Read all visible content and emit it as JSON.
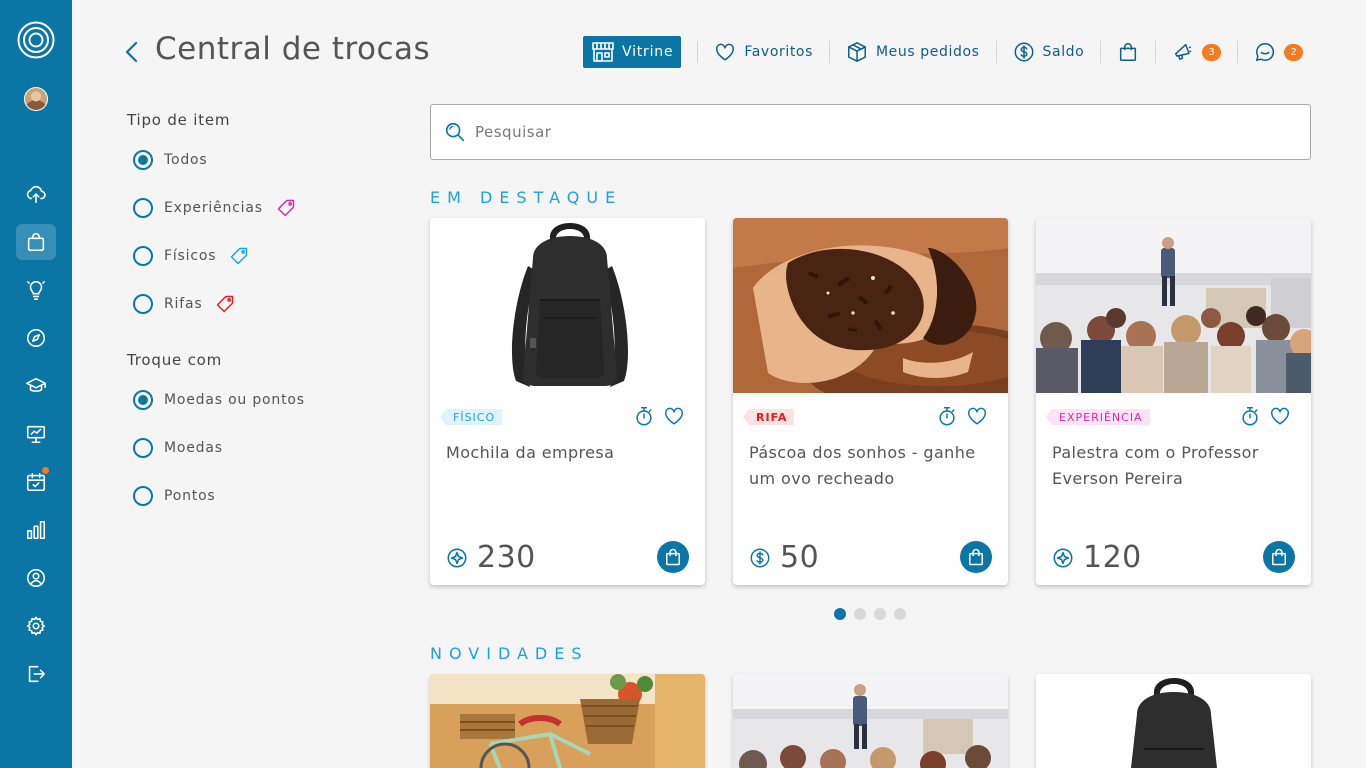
{
  "header": {
    "title": "Central de trocas"
  },
  "nav": {
    "vitrine": "Vitrine",
    "favoritos": "Favoritos",
    "pedidos": "Meus pedidos",
    "saldo": "Saldo",
    "notif_count": "3",
    "msg_count": "2"
  },
  "filters": {
    "tipo_heading": "Tipo de item",
    "tipo_options": [
      "Todos",
      "Experiências",
      "Físicos",
      "Rifas"
    ],
    "tipo_selected": "Todos",
    "troque_heading": "Troque com",
    "troque_options": [
      "Moedas ou pontos",
      "Moedas",
      "Pontos"
    ],
    "troque_selected": "Moedas ou pontos"
  },
  "search": {
    "placeholder": "Pesquisar"
  },
  "featured": {
    "heading": "EM DESTAQUE",
    "cards": [
      {
        "tag": "FÍSICO",
        "title": "Mochila da empresa",
        "price": "230",
        "currency_icon": "points-icon",
        "image": "black-backpack"
      },
      {
        "tag": "RIFA",
        "title": "Páscoa dos sonhos - ganhe um ovo recheado",
        "price": "50",
        "currency_icon": "coin-icon",
        "image": "chocolate-easter-egg"
      },
      {
        "tag": "EXPERIÊNCIA",
        "title": "Palestra com o Professor Everson Pereira",
        "price": "120",
        "currency_icon": "points-icon",
        "image": "lecture-audience"
      }
    ],
    "pagination": {
      "pages": 4,
      "current": 1
    }
  },
  "news": {
    "heading": "NOVIDADES",
    "images": [
      "bicycle-with-basket",
      "lecture-audience",
      "black-backpack"
    ]
  },
  "colors": {
    "primary": "#0b76a6",
    "accent": "#1aa3d6",
    "badge": "#f47c20",
    "rifa": "#e31b23",
    "experiencia": "#d62aa6"
  }
}
